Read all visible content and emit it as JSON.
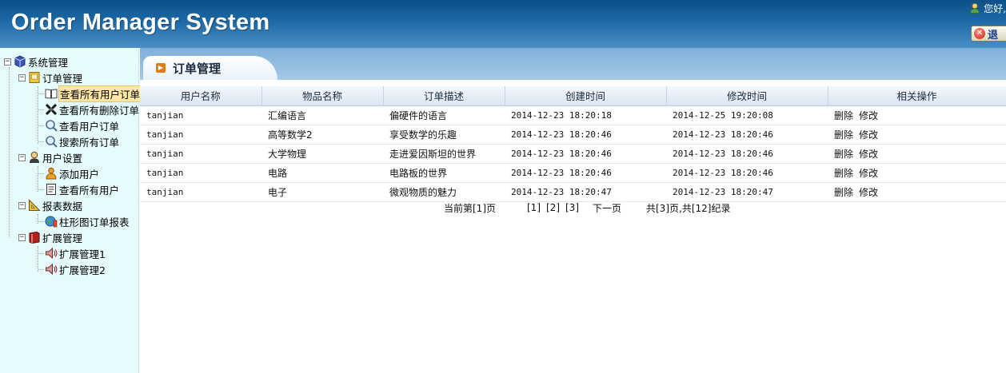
{
  "header": {
    "title": "Order Manager System",
    "greeting": "您好,",
    "logout_label": "退"
  },
  "sidebar": {
    "root": "系统管理",
    "groups": [
      {
        "label": "订单管理",
        "items": [
          "查看所有用户订单",
          "查看所有删除订单",
          "查看用户订单",
          "搜索所有订单"
        ]
      },
      {
        "label": "用户设置",
        "items": [
          "添加用户",
          "查看所有用户"
        ]
      },
      {
        "label": "报表数据",
        "items": [
          "柱形图订单报表"
        ]
      },
      {
        "label": "扩展管理",
        "items": [
          "扩展管理1",
          "扩展管理2"
        ]
      }
    ]
  },
  "main": {
    "tab_title": "订单管理",
    "columns": [
      "用户名称",
      "物品名称",
      "订单描述",
      "创建时间",
      "修改时间",
      "相关操作"
    ],
    "rows": [
      {
        "user": "tanjian",
        "item": "汇编语言",
        "desc": "偏硬件的语言",
        "created": "2014-12-23 18:20:18",
        "modified": "2014-12-25 19:20:08",
        "delete": "删除",
        "edit": "修改"
      },
      {
        "user": "tanjian",
        "item": "高等数学2",
        "desc": "享受数学的乐趣",
        "created": "2014-12-23 18:20:46",
        "modified": "2014-12-23 18:20:46",
        "delete": "删除",
        "edit": "修改"
      },
      {
        "user": "tanjian",
        "item": "大学物理",
        "desc": "走进爱因斯坦的世界",
        "created": "2014-12-23 18:20:46",
        "modified": "2014-12-23 18:20:46",
        "delete": "删除",
        "edit": "修改"
      },
      {
        "user": "tanjian",
        "item": "电路",
        "desc": "电路板的世界",
        "created": "2014-12-23 18:20:46",
        "modified": "2014-12-23 18:20:46",
        "delete": "删除",
        "edit": "修改"
      },
      {
        "user": "tanjian",
        "item": "电子",
        "desc": "微观物质的魅力",
        "created": "2014-12-23 18:20:47",
        "modified": "2014-12-23 18:20:47",
        "delete": "删除",
        "edit": "修改"
      }
    ],
    "pager": {
      "current": "当前第[1]页",
      "pages": [
        "[1]",
        "[2]",
        "[3]"
      ],
      "next": "下一页",
      "summary": "共[3]页,共[12]纪录"
    }
  }
}
